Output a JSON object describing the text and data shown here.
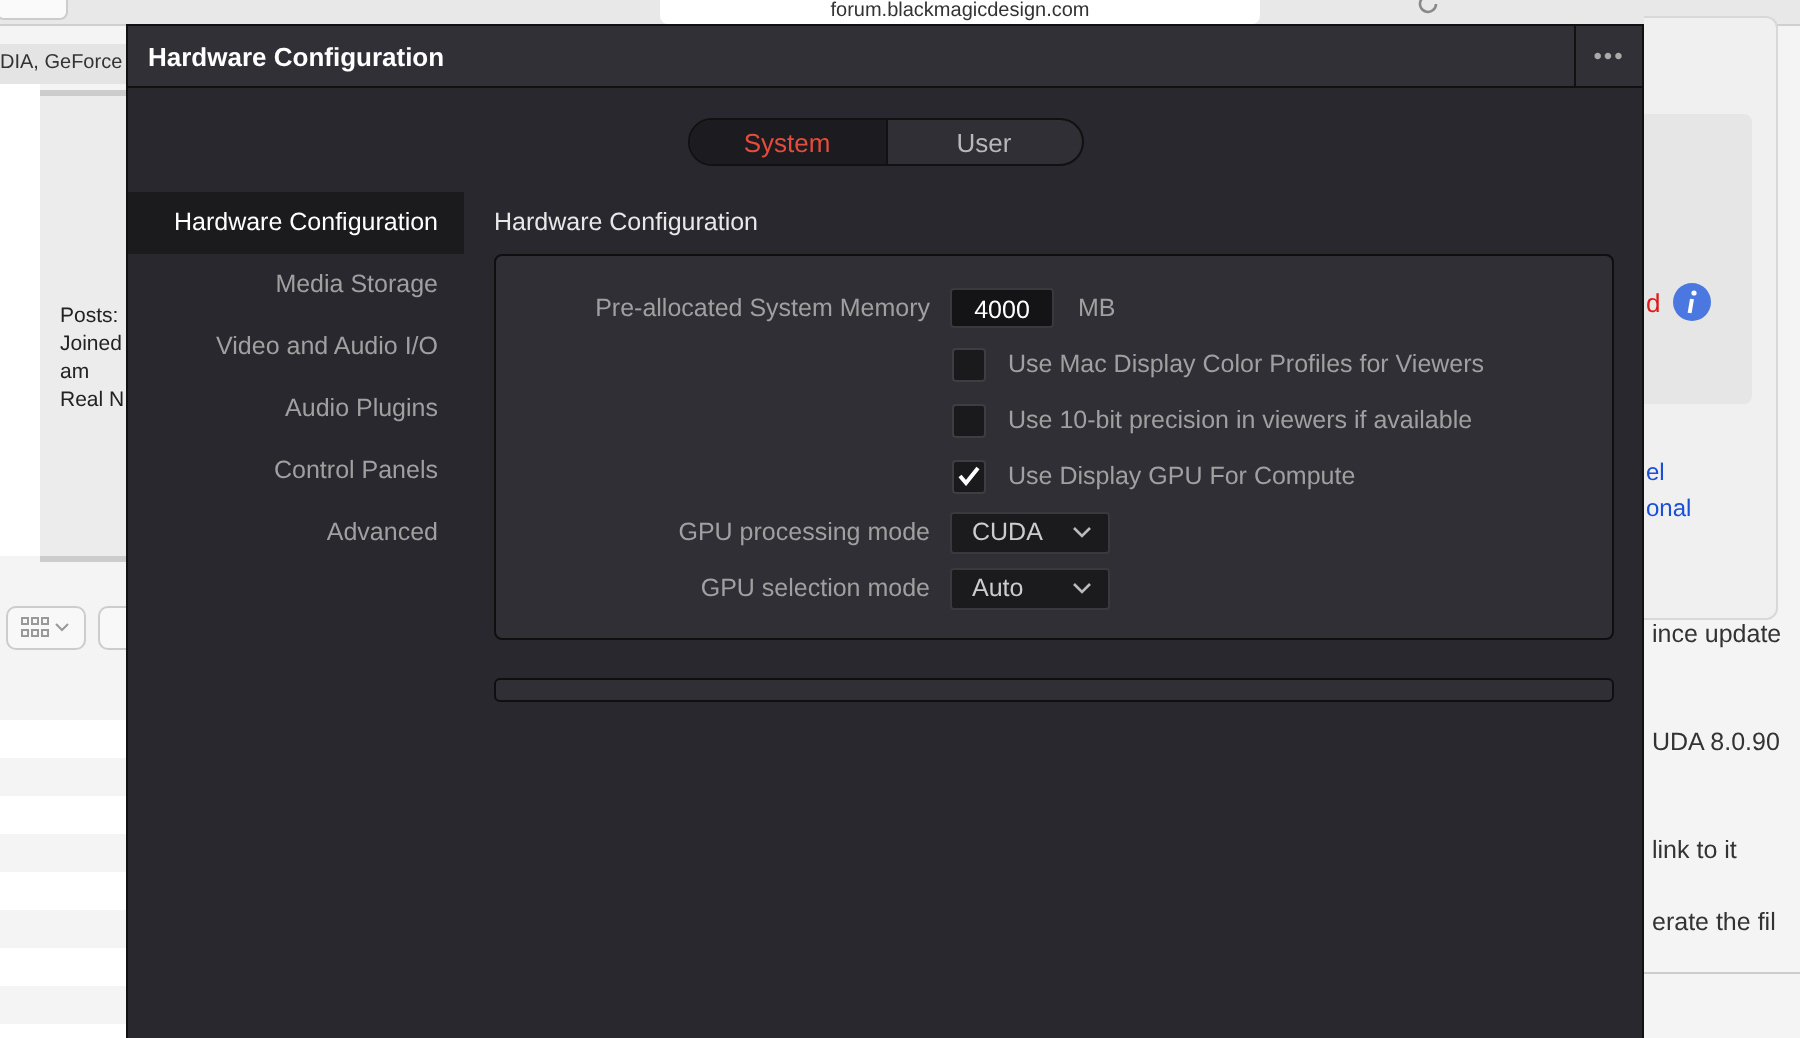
{
  "browser": {
    "address": "forum.blackmagicdesign.com",
    "tab_fragment": "DIA, GeForce",
    "profile_lines": [
      "Posts:",
      "Joined",
      "am",
      "Real N"
    ],
    "popover": {
      "red_fragment": "d",
      "link_lines": [
        "el",
        "onal"
      ]
    },
    "post_lines": [
      "ince update",
      "UDA 8.0.90",
      "link to it",
      "erate the fil"
    ]
  },
  "window": {
    "title": "Hardware Configuration",
    "menu_button": "•••"
  },
  "tabs": [
    {
      "label": "System",
      "selected": true
    },
    {
      "label": "User",
      "selected": false
    }
  ],
  "sidebar": {
    "items": [
      {
        "label": "Hardware Configuration",
        "selected": true
      },
      {
        "label": "Media Storage",
        "selected": false
      },
      {
        "label": "Video and Audio I/O",
        "selected": false
      },
      {
        "label": "Audio Plugins",
        "selected": false
      },
      {
        "label": "Control Panels",
        "selected": false
      },
      {
        "label": "Advanced",
        "selected": false
      }
    ]
  },
  "section": {
    "title": "Hardware Configuration",
    "rows": [
      {
        "kind": "number",
        "label": "Pre-allocated System Memory",
        "value": "4000",
        "unit": "MB"
      },
      {
        "kind": "checkbox",
        "label": "Use Mac Display Color Profiles for Viewers",
        "checked": false
      },
      {
        "kind": "checkbox",
        "label": "Use 10-bit precision in viewers if available",
        "checked": false
      },
      {
        "kind": "checkbox",
        "label": "Use Display GPU For Compute",
        "checked": true
      },
      {
        "kind": "dropdown",
        "label": "GPU processing mode",
        "value": "CUDA"
      },
      {
        "kind": "dropdown",
        "label": "GPU selection mode",
        "value": "Auto"
      }
    ]
  }
}
